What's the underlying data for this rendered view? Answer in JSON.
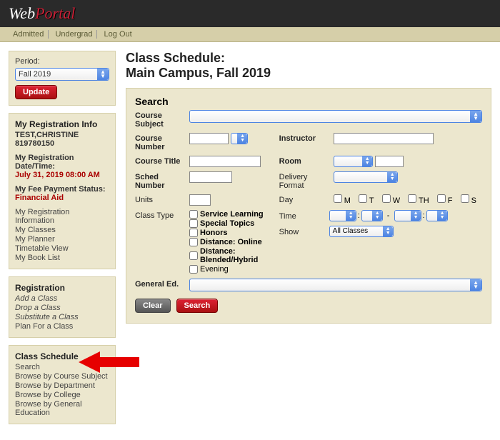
{
  "logo": {
    "part1": "Web",
    "part2": "Portal"
  },
  "topnav": {
    "admitted": "Admitted",
    "undergrad": "Undergrad",
    "logout": "Log Out"
  },
  "period_block": {
    "label": "Period:",
    "selected": "Fall 2019",
    "update": "Update"
  },
  "reginfo": {
    "heading": "My Registration Info",
    "name": "TEST,CHRISTINE",
    "id": "819780150",
    "regdate_label": "My Registration Date/Time:",
    "regdate": "July 31, 2019 08:00 AM",
    "fee_label": "My Fee Payment Status:",
    "fee": "Financial Aid",
    "links": {
      "info": "My Registration Information",
      "classes": "My Classes",
      "planner": "My Planner",
      "timetable": "Timetable View",
      "booklist": "My Book List"
    }
  },
  "registration": {
    "heading": "Registration",
    "add": "Add a Class",
    "drop": "Drop a Class",
    "sub": "Substitute a Class",
    "plan": "Plan For a Class"
  },
  "schedule_block": {
    "heading": "Class Schedule",
    "search": "Search",
    "by_subject": "Browse by Course Subject",
    "by_dept": "Browse by Department",
    "by_college": "Browse by College",
    "by_gened": "Browse by General Education"
  },
  "main": {
    "title_line1": "Class Schedule:",
    "title_line2": "Main Campus, Fall 2019",
    "search_heading": "Search",
    "labels": {
      "course_subject": "Course Subject",
      "course_number": "Course Number",
      "course_title": "Course Title",
      "sched_number": "Sched Number",
      "units": "Units",
      "class_type": "Class Type",
      "instructor": "Instructor",
      "room": "Room",
      "delivery_format": "Delivery Format",
      "day": "Day",
      "time": "Time",
      "show": "Show",
      "general_ed": "General Ed."
    },
    "class_types": {
      "service": "Service Learning",
      "special": "Special Topics",
      "honors": "Honors",
      "dist_online": "Distance: Online",
      "dist_blended": "Distance: Blended/Hybrid",
      "evening": "Evening"
    },
    "days": {
      "m": "M",
      "t": "T",
      "w": "W",
      "th": "TH",
      "f": "F",
      "s": "S"
    },
    "show_value": "All Classes",
    "clear": "Clear",
    "search_btn": "Search"
  }
}
